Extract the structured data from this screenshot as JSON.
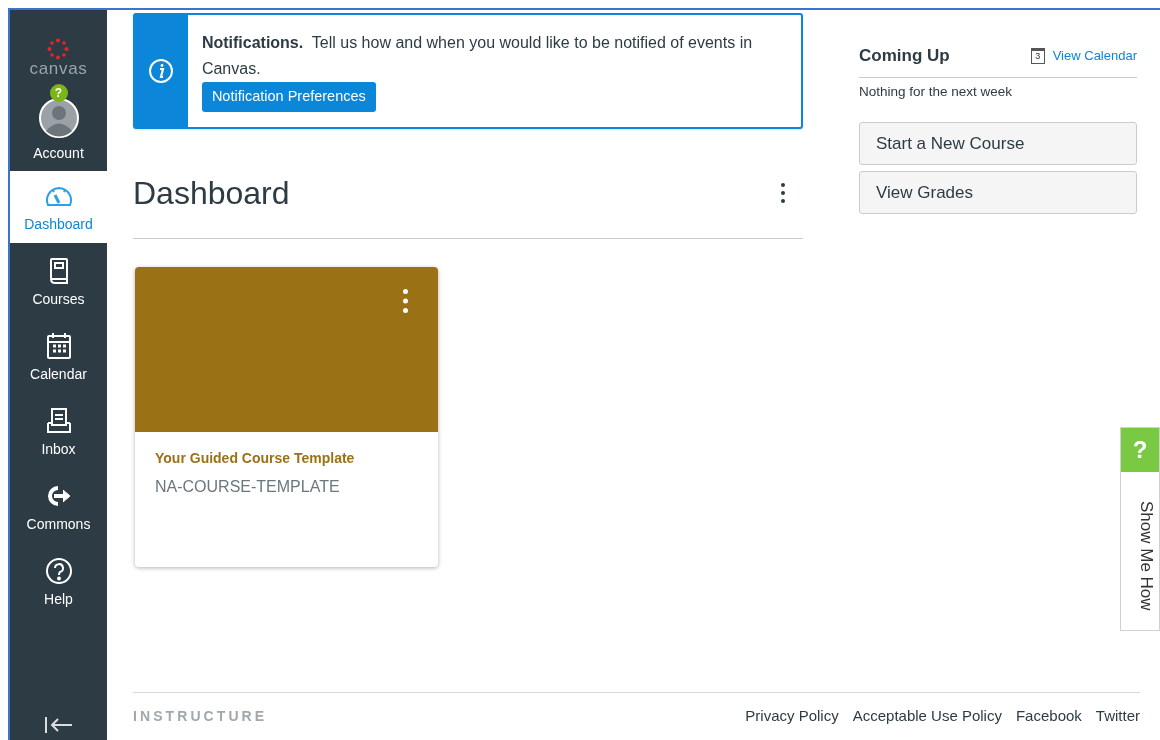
{
  "logo": {
    "wordmark": "canvas"
  },
  "nav": [
    {
      "kind": "account",
      "label": "Account",
      "badge": "?",
      "selected": false
    },
    {
      "kind": "link",
      "label": "Dashboard",
      "selected": true
    },
    {
      "kind": "link",
      "label": "Courses",
      "selected": false
    },
    {
      "kind": "link",
      "label": "Calendar",
      "selected": false
    },
    {
      "kind": "link",
      "label": "Inbox",
      "selected": false
    },
    {
      "kind": "link",
      "label": "Commons",
      "selected": false
    },
    {
      "kind": "link",
      "label": "Help",
      "selected": false
    }
  ],
  "notification": {
    "text": "**Notifications.**  Tell us how and when you would like to be notified of events in Canvas.",
    "button": "Notification Preferences"
  },
  "dashboard": {
    "title": "Dashboard"
  },
  "cards": [
    {
      "color": "#9b7116",
      "title": "Your Guided Course Template",
      "code": "NA-COURSE-TEMPLATE"
    }
  ],
  "coming_up": {
    "title": "Coming Up",
    "calendar_day": "3",
    "link": "View Calendar",
    "empty": "Nothing for the next week"
  },
  "actions": [
    "Start a New Course",
    "View Grades"
  ],
  "footer": {
    "brand": "INSTRUCTURE",
    "links": [
      "Privacy Policy",
      "Acceptable Use Policy",
      "Facebook",
      "Twitter"
    ]
  },
  "show_me_how": {
    "icon": "?",
    "label": "Show Me How"
  }
}
